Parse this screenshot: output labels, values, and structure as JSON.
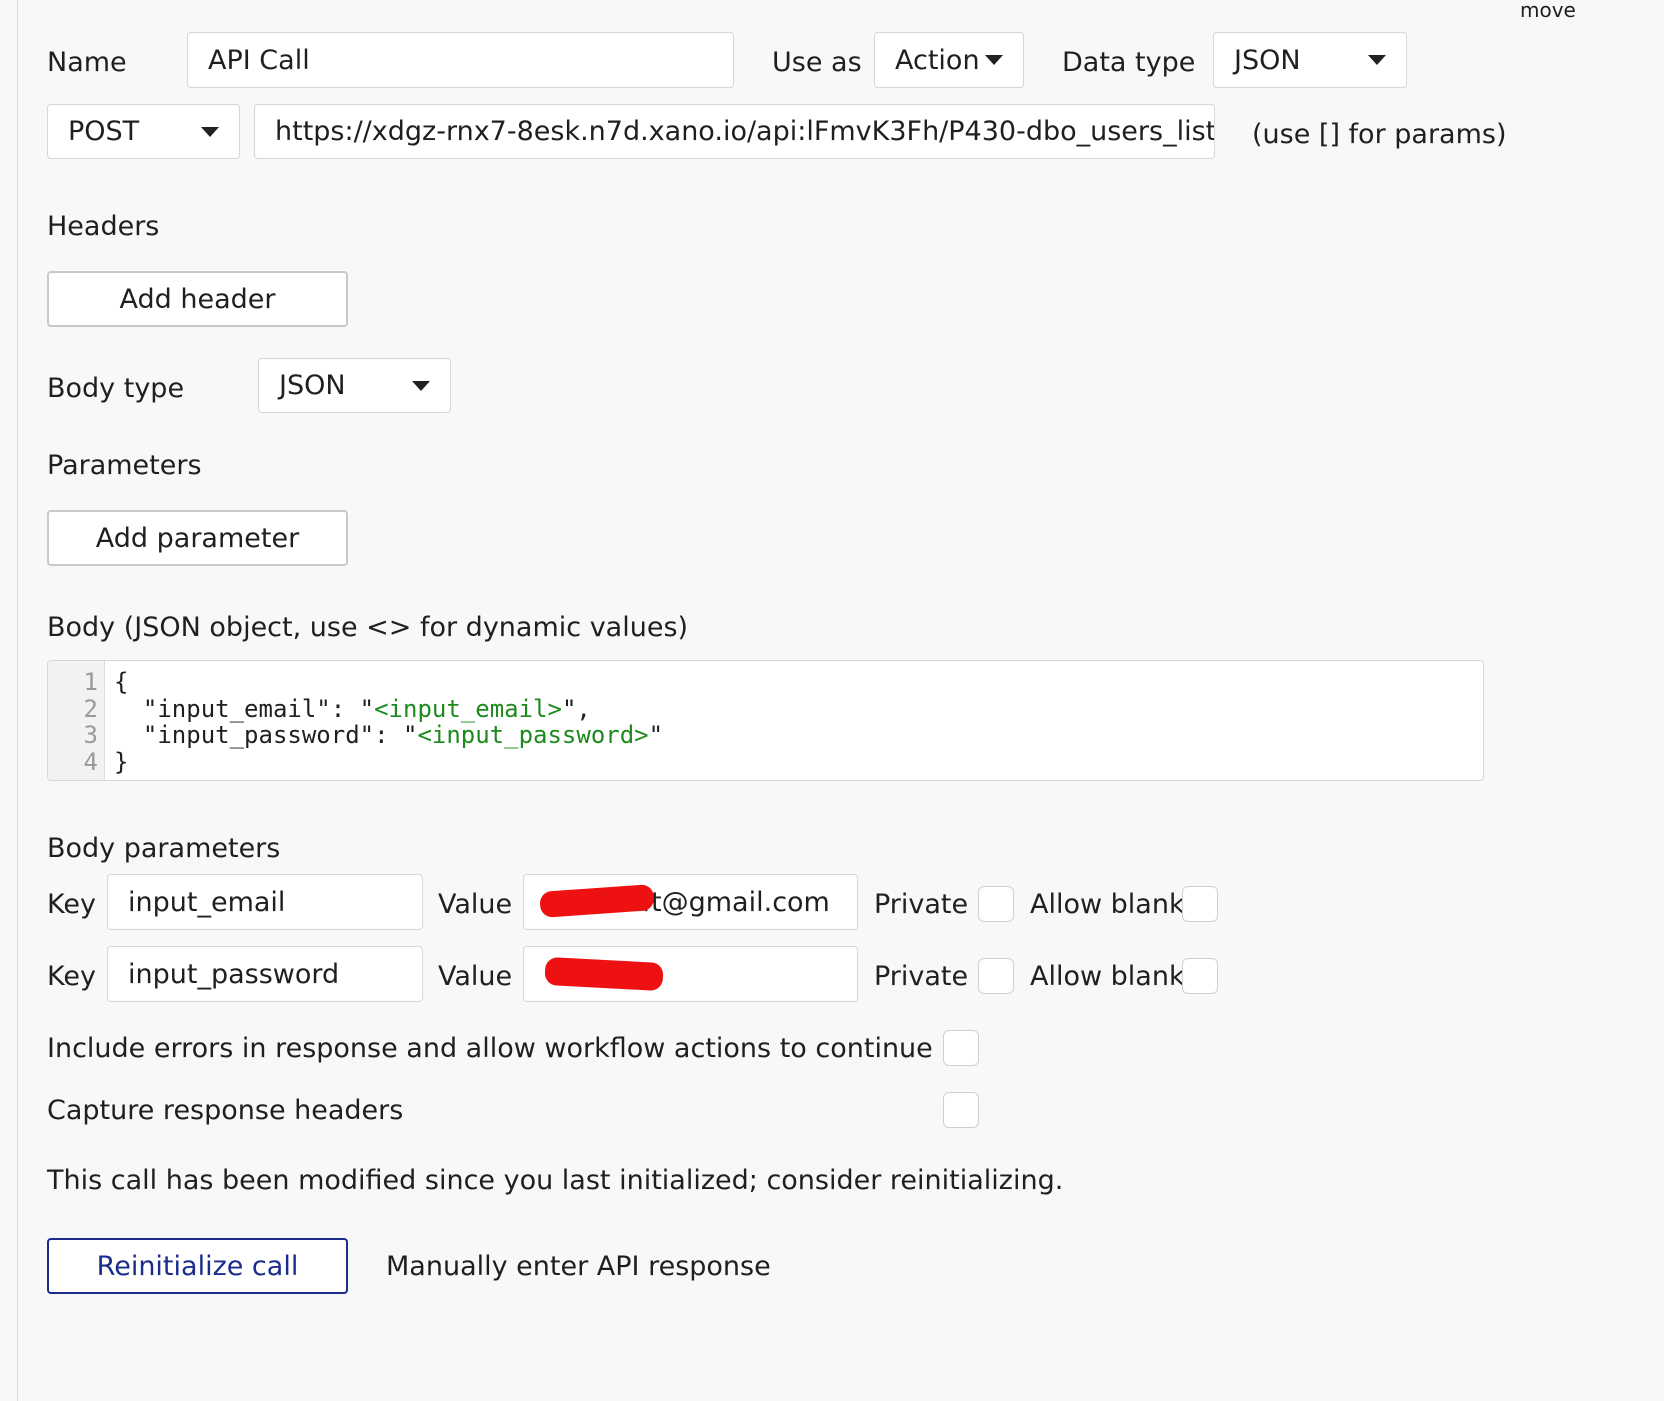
{
  "corner_text": "move",
  "row1": {
    "name_label": "Name",
    "name_value": "API Call",
    "use_as_label": "Use as",
    "use_as_value": "Action",
    "data_type_label": "Data type",
    "data_type_value": "JSON"
  },
  "row2": {
    "method": "POST",
    "url": "https://xdgz-rnx7-8esk.n7d.xano.io/api:lFmvK3Fh/P430-dbo_users_list",
    "params_hint": "(use [] for params)"
  },
  "headers": {
    "heading": "Headers",
    "add_button": "Add header"
  },
  "body_type": {
    "label": "Body type",
    "value": "JSON"
  },
  "parameters": {
    "heading": "Parameters",
    "add_button": "Add parameter"
  },
  "body": {
    "heading": "Body (JSON object, use <> for dynamic values)",
    "line_numbers": [
      "1",
      "2",
      "3",
      "4"
    ],
    "lines": [
      {
        "pre": "{",
        "dyn": "",
        "post": ""
      },
      {
        "pre": "  \"input_email\": \"",
        "dyn": "<input_email>",
        "post": "\","
      },
      {
        "pre": "  \"input_password\": \"",
        "dyn": "<input_password>",
        "post": "\""
      },
      {
        "pre": "}",
        "dyn": "",
        "post": ""
      }
    ]
  },
  "body_parameters": {
    "heading": "Body parameters",
    "rows": [
      {
        "key_label": "Key",
        "key_value": "input_email",
        "value_label": "Value",
        "value_visible": "ft@gmail.com",
        "private_label": "Private",
        "private_checked": false,
        "allow_blank_label": "Allow blank",
        "allow_blank_checked": false
      },
      {
        "key_label": "Key",
        "key_value": "input_password",
        "value_label": "Value",
        "value_visible": "",
        "private_label": "Private",
        "private_checked": false,
        "allow_blank_label": "Allow blank",
        "allow_blank_checked": false
      }
    ]
  },
  "options": {
    "include_errors_label": "Include errors in response and allow workflow actions to continue",
    "include_errors_checked": false,
    "capture_headers_label": "Capture response headers",
    "capture_headers_checked": false
  },
  "notice": "This call has been modified since you last initialized; consider reinitializing.",
  "actions": {
    "reinitialize": "Reinitialize call",
    "manual_entry": "Manually enter API response"
  },
  "colors": {
    "primary_button": "#1a2c8c",
    "dynamic_value": "#1e8a1e",
    "redaction": "#ee1111"
  }
}
